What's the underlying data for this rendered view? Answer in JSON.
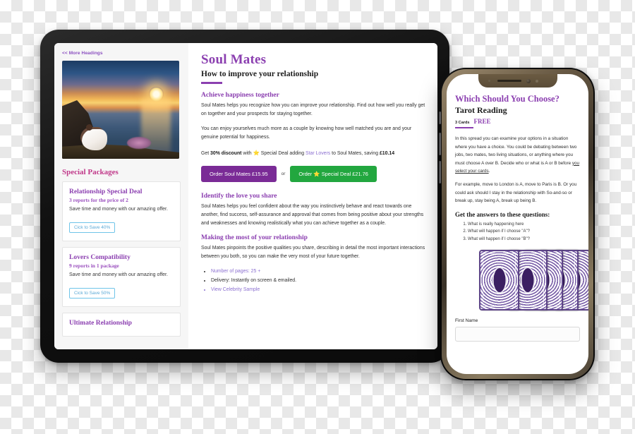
{
  "tablet": {
    "sidebar": {
      "more_headings": "<< More Headings",
      "hero_image_alt": "Couple sitting on a cliff watching an ocean sunset",
      "packages_title": "Special Packages",
      "packages": [
        {
          "name": "Relationship Special Deal",
          "subtitle": "3 reports for the price of 2",
          "description": "Save time and money with our amazing offer.",
          "button": "Cick to Save 40%"
        },
        {
          "name": "Lovers Compatibility",
          "subtitle": "9 reports in 1 package",
          "description": "Save time and money with our amazing offer.",
          "button": "Cick to Save 50%"
        },
        {
          "name": "Ultimate Relationship",
          "subtitle": "",
          "description": "",
          "button": ""
        }
      ]
    },
    "main": {
      "title": "Soul Mates",
      "subtitle": "How to improve your relationship",
      "section1_heading": "Achieve happiness together",
      "section1_p1": "Soul Mates helps you recognize how you can improve your relationship. Find out how well you really get on together and your prospects for staying together.",
      "section1_p2": "You can enjoy yourselves much more as a couple by knowing how well matched you are and your genuine potential for happiness.",
      "discount_prefix": "Get ",
      "discount_bold": "30% discount",
      "discount_mid": " with ",
      "discount_star": "⭐",
      "discount_mid2": " Special Deal adding ",
      "discount_link": "Star Lovers",
      "discount_mid3": " to Soul Mates, saving ",
      "discount_amount": "£10.14",
      "btn_purple": "Order Soul Mates £15.95",
      "btn_or": "or",
      "btn_green_pre": "Order ",
      "btn_green_star": "⭐",
      "btn_green_post": " Special Deal £21.76",
      "section2_heading": "Identify the love you share",
      "section2_p": "Soul Mates helps you feel confident about the way you instinctively behave and react towards one another, find success, self-assurance and approval that comes from being positive about your strengths and weaknesses and knowing realistically what you can achieve together as a couple.",
      "section3_heading": "Making the most of your relationship",
      "section3_p": "Soul Mates pinpoints the positive qualities you share, describing in detail the most important interactions between you both, so you can make the very most of your future together.",
      "bullets": [
        "Number of pages: 25 +",
        "Delivery: Instantly on screen & emailed.",
        "View Celebrity Sample"
      ]
    }
  },
  "phone": {
    "title": "Which Should You Choose?",
    "subtitle": "Tarot Reading",
    "cards_count": "3 Cards",
    "price": "FREE",
    "p1": "In this spread you can examine your options in a situation where you have a choice. You could be debating between two jobs, two mates, two living situations, or anything where you must choose A over B. Decide who or what is A or B before ",
    "p1_link": "you select your cards",
    "p1_end": ".",
    "p2": "For example, move to London is A, move to Paris is B. Or you could ask should I stay in the relationship with So-and-so or break up, stay being A, break up being B.",
    "questions_heading": "Get the answers to these questions:",
    "questions": [
      "What is really happening here",
      "What will happen if I choose \"A\"?",
      "What will happen if I choose \"B\"?"
    ],
    "deck_alt": "Fanned deck of five purple tarot card backs",
    "first_name_label": "First Name",
    "first_name_value": "",
    "first_name_placeholder": ""
  },
  "colors": {
    "brand_purple": "#8b3fb0",
    "button_purple": "#7a2b96",
    "button_green": "#22a73f",
    "pink_heading": "#c0398a",
    "link_blue": "#5aa9d6",
    "star_gold": "#f5b91a"
  }
}
